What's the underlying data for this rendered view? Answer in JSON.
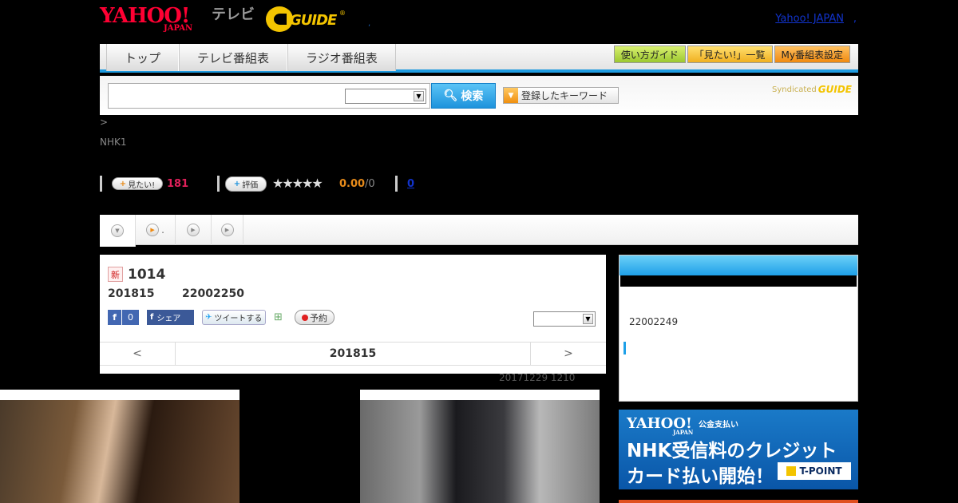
{
  "header": {
    "yahoo_logo": "YAHOO!",
    "yahoo_sub": "JAPAN",
    "tv_label": "テレビ",
    "gguide_logo": "GUIDE",
    "gguide_reg": "®",
    "dot": ",",
    "yj_link": "Yahoo! JAPAN",
    "yj_dot": ","
  },
  "nav": {
    "tabs": [
      "トップ",
      "テレビ番組表",
      "ラジオ番組表"
    ],
    "buttons": [
      "使い方ガイド",
      "「見たい!」一覧",
      "My番組表設定"
    ]
  },
  "search": {
    "input_value": "",
    "select_value": "",
    "button_label": "検索",
    "keyword_button": "登録したキーワード",
    "syndicated": "Syndicated",
    "syndicated_logo": "GUIDE"
  },
  "crumb": ">",
  "channel": "NHK1",
  "rating": {
    "mitai_label": "見たい!",
    "mitai_count": "181",
    "hyouka_label": "評価",
    "stars": "★★★★★",
    "score": "0.00",
    "score_sub": "/0",
    "link": "0"
  },
  "tabstrip": {
    "tab2_dot": "."
  },
  "program": {
    "new_badge": "新",
    "title": "1014",
    "date": "201815",
    "code": "22002250",
    "fb_like": "f",
    "fb_like_count": "0",
    "fb_share": "シェア",
    "tweet": "ツイートする",
    "yoyaku": "予約",
    "prev": "<",
    "date_nav": "201815",
    "next": ">"
  },
  "updated": "20171229  1210",
  "sidebar": {
    "code": "22002249"
  },
  "banner": {
    "yahoo": "YAHOO!",
    "japan": "JAPAN",
    "koukin": "公金支払い",
    "line1": "NHK受信料のクレジット",
    "line2": "カード払い開始！",
    "tpoint": "T-POINT"
  }
}
